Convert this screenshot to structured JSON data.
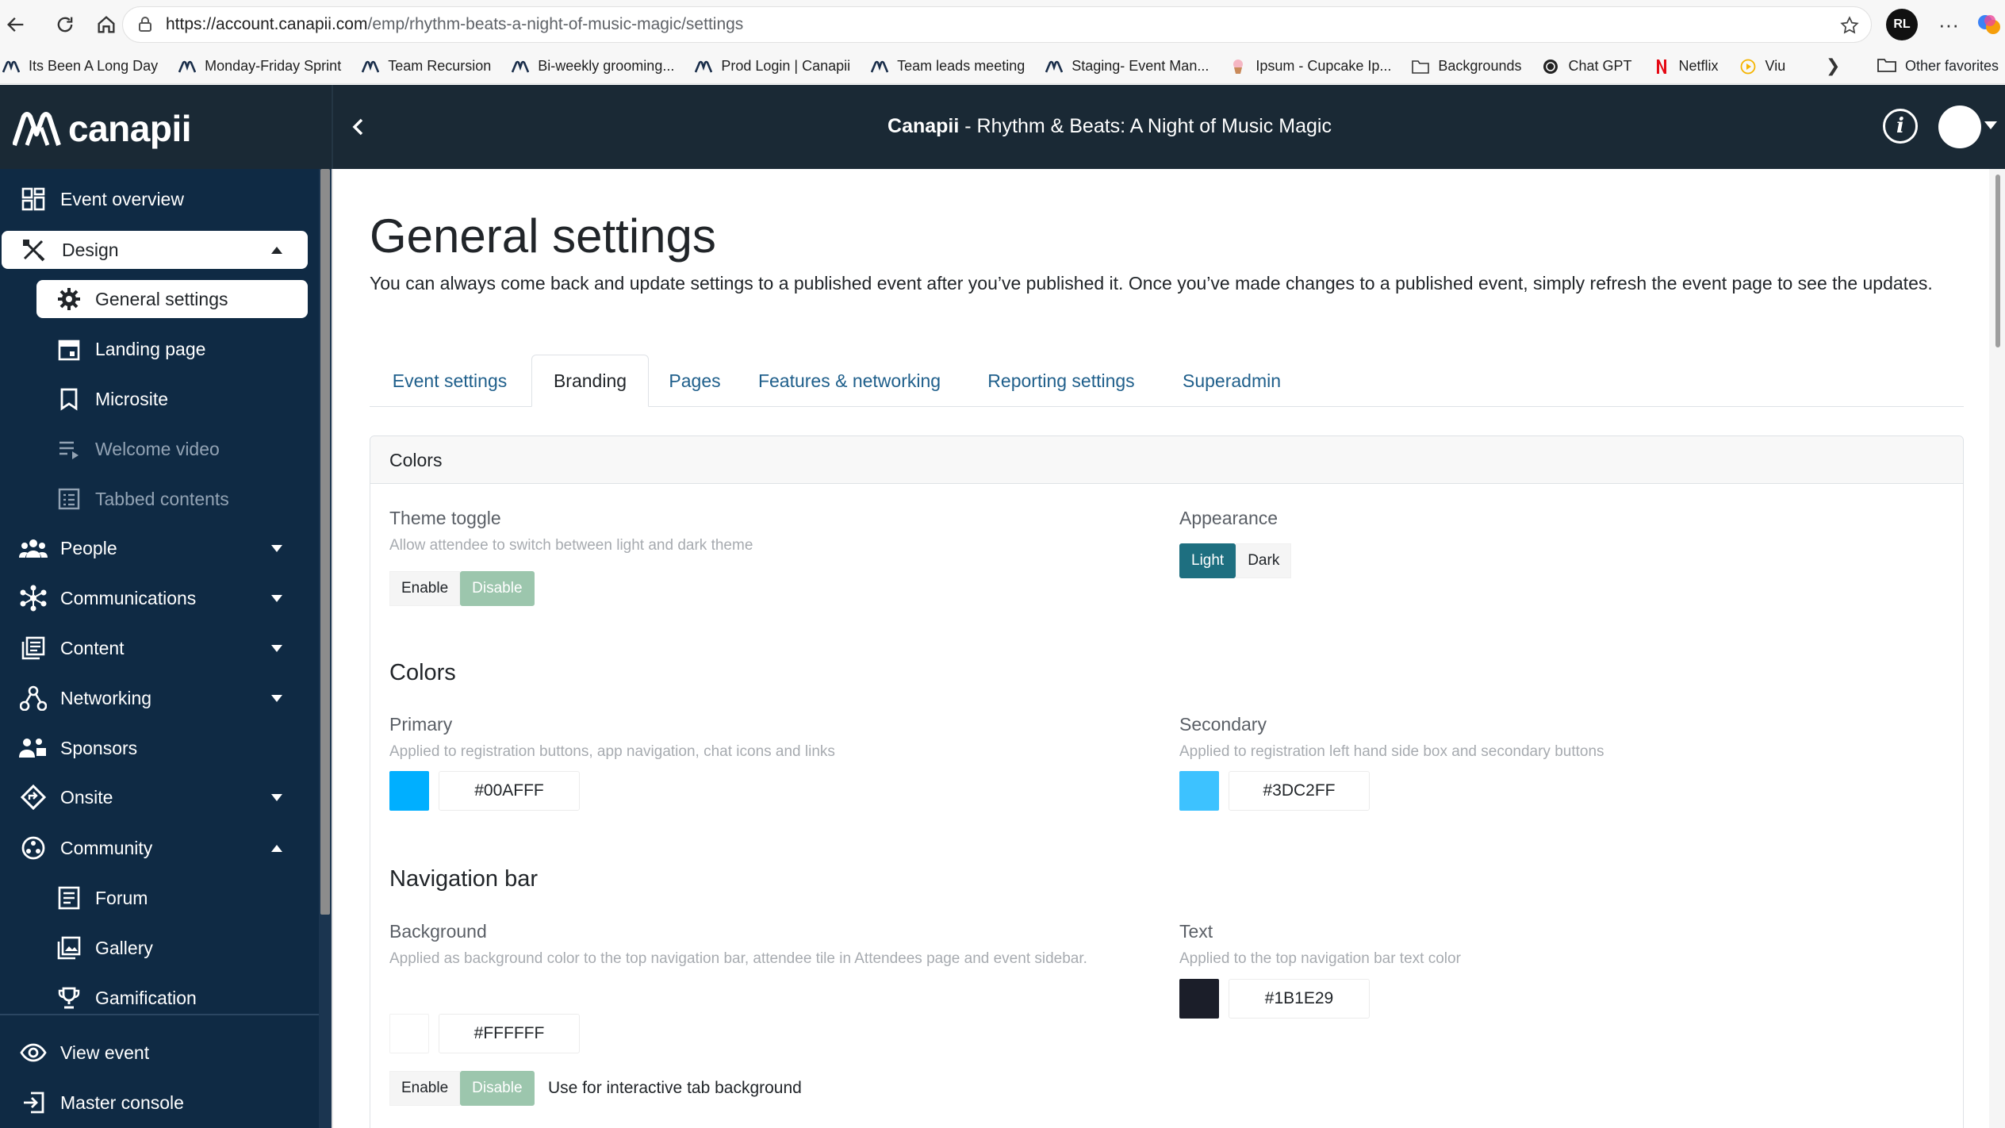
{
  "browser": {
    "url_host": "https://account.canapii.com",
    "url_path": "/emp/rhythm-beats-a-night-of-music-magic/settings",
    "profile_initials": "RL",
    "bookmarks": [
      {
        "label": "Its Been A Long Day",
        "icon": "canapii-icon"
      },
      {
        "label": "Monday-Friday Sprint",
        "icon": "canapii-icon"
      },
      {
        "label": "Team Recursion",
        "icon": "canapii-icon"
      },
      {
        "label": "Bi-weekly grooming...",
        "icon": "canapii-icon"
      },
      {
        "label": "Prod Login | Canapii",
        "icon": "canapii-icon"
      },
      {
        "label": "Team leads meeting",
        "icon": "canapii-icon"
      },
      {
        "label": "Staging- Event Man...",
        "icon": "canapii-icon"
      },
      {
        "label": "Ipsum - Cupcake Ip...",
        "icon": "cupcake-icon"
      },
      {
        "label": "Backgrounds",
        "icon": "folder-icon"
      },
      {
        "label": "Chat GPT",
        "icon": "chatgpt-icon"
      },
      {
        "label": "Netflix",
        "icon": "netflix-icon"
      },
      {
        "label": "Viu",
        "icon": "viu-icon"
      }
    ],
    "other_favorites": "Other favorites"
  },
  "app": {
    "logo_text": "canapii",
    "header_brand": "Canapii",
    "header_event": " - Rhythm & Beats: A Night of Music Magic"
  },
  "sidebar": {
    "event_overview": "Event overview",
    "design": "Design",
    "general_settings": "General settings",
    "landing_page": "Landing page",
    "microsite": "Microsite",
    "welcome_video": "Welcome video",
    "tabbed_contents": "Tabbed contents",
    "people": "People",
    "communications": "Communications",
    "content": "Content",
    "networking": "Networking",
    "sponsors": "Sponsors",
    "onsite": "Onsite",
    "community": "Community",
    "forum": "Forum",
    "gallery": "Gallery",
    "gamification": "Gamification",
    "view_event": "View event",
    "master_console": "Master console"
  },
  "page": {
    "title": "General settings",
    "description": "You can always come back and update settings to a published event after you’ve published it. Once you’ve made changes to a published event, simply refresh the event page to see the updates."
  },
  "tabs": {
    "event_settings": "Event settings",
    "branding": "Branding",
    "pages": "Pages",
    "features": "Features & networking",
    "reporting": "Reporting settings",
    "superadmin": "Superadmin"
  },
  "card": {
    "header": "Colors",
    "theme_toggle": {
      "label": "Theme toggle",
      "help": "Allow attendee to switch between light and dark theme",
      "enable": "Enable",
      "disable": "Disable",
      "selected": "Disable"
    },
    "appearance": {
      "label": "Appearance",
      "light": "Light",
      "dark": "Dark",
      "selected": "Light"
    },
    "colors_title": "Colors",
    "primary": {
      "label": "Primary",
      "help": "Applied to registration buttons, app navigation, chat icons and links",
      "hex": "#00AFFF",
      "color": "#00AFFF"
    },
    "secondary": {
      "label": "Secondary",
      "help": "Applied to registration left hand side box and secondary buttons",
      "hex": "#3DC2FF",
      "color": "#3DC2FF"
    },
    "navbar_title": "Navigation bar",
    "nav_background": {
      "label": "Background",
      "help": "Applied as background color to the top navigation bar, attendee tile in Attendees page and event sidebar.",
      "hex": "#FFFFFF",
      "color": "#FFFFFF"
    },
    "nav_text": {
      "label": "Text",
      "help": "Applied to the top navigation bar text color",
      "hex": "#1B1E29",
      "color": "#1B1E29"
    },
    "interactive_tab": {
      "enable": "Enable",
      "disable": "Disable",
      "selected": "Disable",
      "note": "Use for interactive tab background"
    }
  },
  "colors": {
    "sidebar_bg": "#0f2a44",
    "header_bg": "#1a2935",
    "tab_link": "#1f5f8b",
    "toggle_selected": "#9cc6ad",
    "appearance_selected": "#1e6f80"
  }
}
